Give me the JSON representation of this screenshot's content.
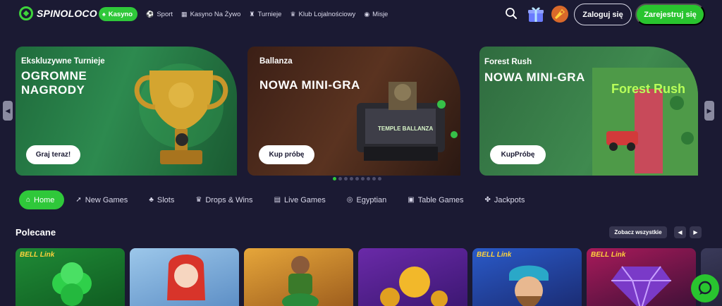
{
  "brand": {
    "name": "SPINOLOCO",
    "accent": "#2fc83a"
  },
  "nav": [
    {
      "label": "Kasyno",
      "icon": "casino-icon",
      "active": true
    },
    {
      "label": "Sport",
      "icon": "sport-icon"
    },
    {
      "label": "Kasyno Na Żywo",
      "icon": "live-casino-icon"
    },
    {
      "label": "Turnieje",
      "icon": "tournament-icon"
    },
    {
      "label": "Klub Lojalnościowy",
      "icon": "crown-icon"
    },
    {
      "label": "Misje",
      "icon": "missions-icon"
    }
  ],
  "auth": {
    "login": "Zaloguj się",
    "register": "Zarejestruj się"
  },
  "banners": [
    {
      "eyebrow": "Ekskluzywne Turnieje",
      "title": "OGROMNE NAGRODY",
      "cta": "Graj teraz!"
    },
    {
      "eyebrow": "Ballanza",
      "title": "NOWA MINI-GRA",
      "cta": "Kup próbę",
      "art_text": "TEMPLE BALLANZA"
    },
    {
      "eyebrow": "Forest Rush",
      "title": "NOWA MINI-GRA",
      "cta": "KupPróbę",
      "art_text": "Forest Rush"
    }
  ],
  "carousel": {
    "dots": 9,
    "active": 1
  },
  "categories": [
    {
      "label": "Home",
      "icon": "home-icon",
      "active": true
    },
    {
      "label": "New Games",
      "icon": "rocket-icon"
    },
    {
      "label": "Slots",
      "icon": "cherries-icon"
    },
    {
      "label": "Drops & Wins",
      "icon": "crown-icon"
    },
    {
      "label": "Live Games",
      "icon": "cards-icon"
    },
    {
      "label": "Egyptian",
      "icon": "eye-icon"
    },
    {
      "label": "Table Games",
      "icon": "table-icon"
    },
    {
      "label": "Jackpots",
      "icon": "clover-icon"
    }
  ],
  "section": {
    "title": "Polecane",
    "see_all": "Zobacz wszystkie"
  },
  "tiles": [
    {
      "badge": "BELL Link"
    },
    {
      "badge": ""
    },
    {
      "badge": ""
    },
    {
      "badge": ""
    },
    {
      "badge": "BELL Link"
    },
    {
      "badge": "BELL Link"
    },
    {
      "badge": ""
    }
  ]
}
